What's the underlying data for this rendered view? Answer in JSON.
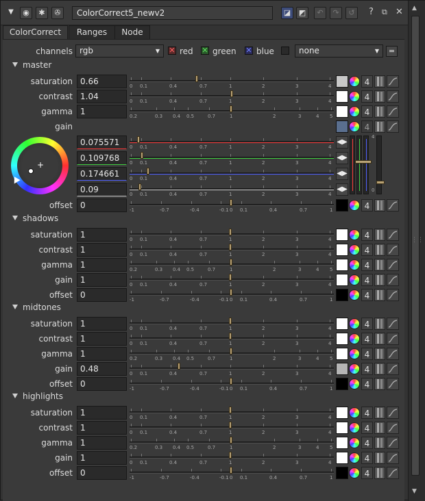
{
  "window": {
    "node_name": "ColorCorrect5_newv2"
  },
  "tabs": [
    "ColorCorrect",
    "Ranges",
    "Node"
  ],
  "channels": {
    "label": "channels",
    "value": "rgb",
    "red": "red",
    "green": "green",
    "blue": "blue",
    "mask": "none",
    "eq": "="
  },
  "colors": {
    "red": "#ff3b3b",
    "green": "#40d040",
    "blue": "#5060ff",
    "handle": "#b9a274"
  },
  "scales": {
    "a": [
      "0",
      "0.1",
      "0.4",
      "0.7",
      "1",
      "2",
      "3",
      "4"
    ],
    "g": [
      "0.2",
      "0.3",
      "0.4",
      "0.5",
      "0.7",
      "1",
      "2",
      "3",
      "4",
      "5"
    ],
    "o": [
      "-1",
      "-0.7",
      "-0.4",
      "-0.1",
      "0",
      "0.1",
      "0.4",
      "0.7",
      "1"
    ]
  },
  "sections": [
    {
      "title": "master",
      "rows": [
        {
          "label": "saturation",
          "value": "0.66",
          "scale": "a",
          "pos": 0.66,
          "swatch": "#c8c8c8"
        },
        {
          "label": "contrast",
          "value": "1.04",
          "scale": "a",
          "pos": 1.04,
          "swatch": "#ffffff"
        },
        {
          "label": "gamma",
          "value": "1",
          "scale": "g",
          "pos": 1,
          "swatch": "#ffffff"
        },
        {
          "label": "gain",
          "value": "",
          "scale": "",
          "pos": 0,
          "swatch": "#5a6f8f",
          "four_dim": true
        },
        {
          "label": "",
          "value": "0.075571",
          "scale": "a",
          "pos": 0.075571,
          "arrow": true,
          "color": "#ff3b3b"
        },
        {
          "label": "",
          "value": "0.109768",
          "scale": "a",
          "pos": 0.109768,
          "arrow": true,
          "color": "#40d040"
        },
        {
          "label": "",
          "value": "0.174661",
          "scale": "a",
          "pos": 0.174661,
          "arrow": true,
          "color": "#5060ff"
        },
        {
          "label": "",
          "value": "0.09",
          "scale": "a",
          "pos": 0.09,
          "arrow": true,
          "color": "#cccccc"
        },
        {
          "label": "offset",
          "value": "0",
          "scale": "o",
          "pos": 0,
          "swatch": "#000000"
        }
      ]
    },
    {
      "title": "shadows",
      "rows": [
        {
          "label": "saturation",
          "value": "1",
          "scale": "a",
          "pos": 1,
          "swatch": "#ffffff"
        },
        {
          "label": "contrast",
          "value": "1",
          "scale": "a",
          "pos": 1,
          "swatch": "#ffffff"
        },
        {
          "label": "gamma",
          "value": "1",
          "scale": "g",
          "pos": 1,
          "swatch": "#ffffff"
        },
        {
          "label": "gain",
          "value": "1",
          "scale": "a",
          "pos": 1,
          "swatch": "#ffffff"
        },
        {
          "label": "offset",
          "value": "0",
          "scale": "o",
          "pos": 0,
          "swatch": "#000000"
        }
      ]
    },
    {
      "title": "midtones",
      "rows": [
        {
          "label": "saturation",
          "value": "1",
          "scale": "a",
          "pos": 1,
          "swatch": "#ffffff"
        },
        {
          "label": "contrast",
          "value": "1",
          "scale": "a",
          "pos": 1,
          "swatch": "#ffffff"
        },
        {
          "label": "gamma",
          "value": "1",
          "scale": "g",
          "pos": 1,
          "swatch": "#ffffff"
        },
        {
          "label": "gain",
          "value": "0.48",
          "scale": "a",
          "pos": 0.48,
          "swatch": "#b5b5b5"
        },
        {
          "label": "offset",
          "value": "0",
          "scale": "o",
          "pos": 0,
          "swatch": "#000000"
        }
      ]
    },
    {
      "title": "highlights",
      "rows": [
        {
          "label": "saturation",
          "value": "1",
          "scale": "a",
          "pos": 1,
          "swatch": "#ffffff"
        },
        {
          "label": "contrast",
          "value": "1",
          "scale": "a",
          "pos": 1,
          "swatch": "#ffffff"
        },
        {
          "label": "gamma",
          "value": "1",
          "scale": "g",
          "pos": 1,
          "swatch": "#ffffff"
        },
        {
          "label": "gain",
          "value": "1",
          "scale": "a",
          "pos": 1,
          "swatch": "#ffffff"
        },
        {
          "label": "offset",
          "value": "0",
          "scale": "o",
          "pos": 0,
          "swatch": "#000000"
        }
      ]
    }
  ],
  "four": "4",
  "vscale": {
    "top": "4",
    "bottom": "0"
  }
}
